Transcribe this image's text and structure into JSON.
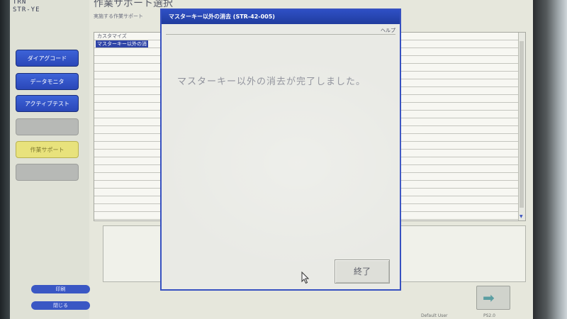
{
  "header": {
    "ids": [
      "TRN",
      "STR-YE"
    ],
    "title": "作業サポート選択",
    "subtitle": "実施する作業サポート"
  },
  "sidebar": {
    "buttons": [
      {
        "label": "ダイアグコード",
        "state": "blue"
      },
      {
        "label": "データモニタ",
        "state": "blue"
      },
      {
        "label": "アクティブテスト",
        "state": "blue"
      },
      {
        "label": "",
        "state": "grey"
      },
      {
        "label": "作業サポート",
        "state": "yellow"
      },
      {
        "label": "",
        "state": "grey"
      }
    ],
    "small_buttons": [
      "印刷",
      "閉じる"
    ]
  },
  "list": {
    "items": [
      {
        "label": "カスタマイズ",
        "selected": false
      },
      {
        "label": "マスターキー以外の消",
        "selected": true
      }
    ]
  },
  "dialog": {
    "title": "マスターキー以外の消去 (STR-42-005)",
    "help_label": "ヘルプ",
    "message": "マスターキー以外の消去が完了しました。",
    "end_button": "終了"
  },
  "footer": {
    "info_left": "Default User",
    "info_right": "PS2.0"
  },
  "colors": {
    "accent_blue": "#2f4fc4",
    "sidebar_yellow": "#e8e27c",
    "screen_bg": "#e6e7dc"
  },
  "icons": {
    "next": "arrow-right-icon",
    "cursor": "mouse-pointer-icon"
  }
}
